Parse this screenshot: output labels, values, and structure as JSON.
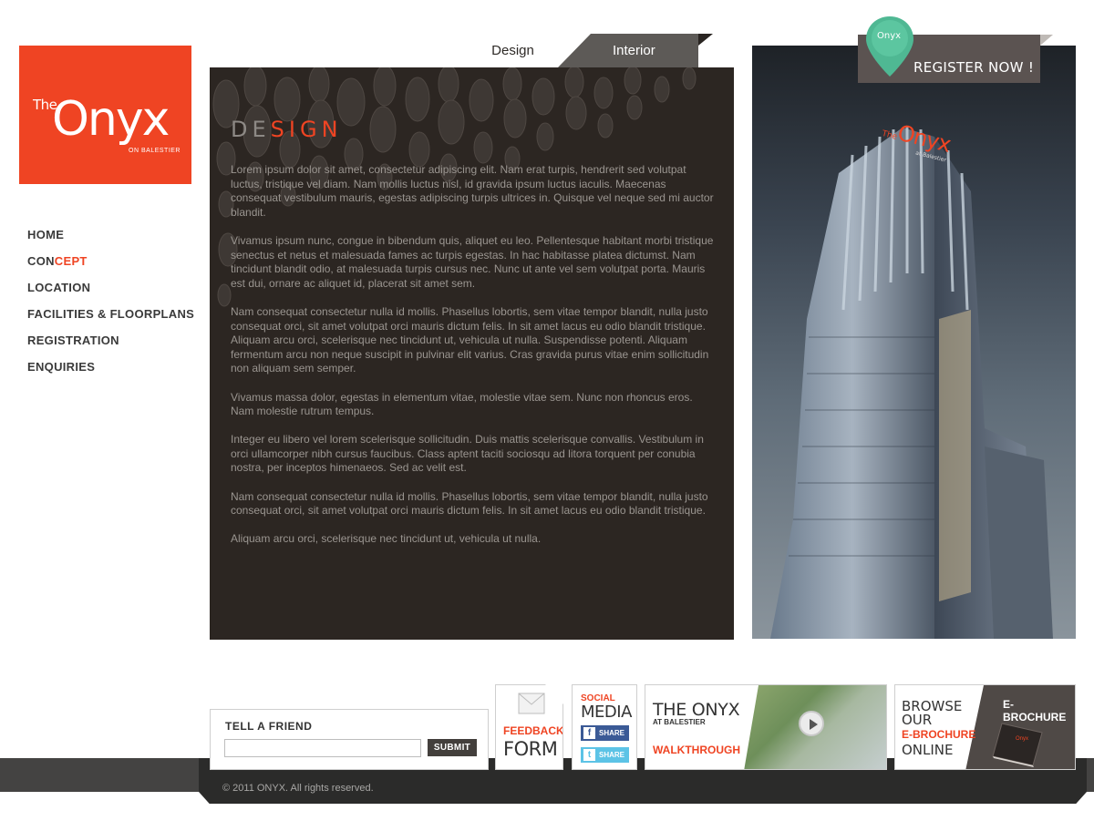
{
  "logo": {
    "the": "The",
    "word": "Onyx",
    "sub": "ON BALESTIER"
  },
  "nav": {
    "items": [
      {
        "label": "HOME"
      },
      {
        "pre": "CON",
        "hl": "CEPT"
      },
      {
        "label": "LOCATION"
      },
      {
        "label": "FACILITIES & FLOORPLANS"
      },
      {
        "label": "REGISTRATION"
      },
      {
        "label": "ENQUIRIES"
      }
    ]
  },
  "tabs": {
    "design": "Design",
    "interior": "Interior"
  },
  "content": {
    "heading_pre": "DE",
    "heading_hl": "SIGN",
    "paragraphs": [
      "Lorem ipsum dolor sit amet, consectetur adipiscing elit. Nam erat turpis, hendrerit sed volutpat luctus, tristique vel diam. Nam mollis luctus nisl, id gravida ipsum luctus iaculis. Maecenas consequat vestibulum mauris, egestas adipiscing turpis ultrices in. Quisque vel neque sed mi auctor blandit.",
      "Vivamus ipsum nunc, congue in bibendum quis, aliquet eu leo. Pellentesque habitant morbi tristique senectus et netus et malesuada fames ac turpis egestas. In hac habitasse platea dictumst. Nam tincidunt blandit odio, at malesuada turpis cursus nec. Nunc ut ante vel sem volutpat porta. Mauris est dui, ornare ac aliquet id, placerat sit amet sem.",
      "Nam consequat consectetur nulla id mollis. Phasellus lobortis, sem vitae tempor blandit, nulla justo consequat orci, sit amet volutpat orci mauris dictum felis. In sit amet lacus eu odio blandit tristique. Aliquam arcu orci, scelerisque nec tincidunt ut, vehicula ut nulla. Suspendisse potenti. Aliquam fermentum arcu non neque suscipit in pulvinar elit varius. Cras gravida purus vitae enim sollicitudin non aliquam sem semper.",
      "Vivamus massa dolor, egestas in elementum vitae, molestie vitae sem. Nunc non rhoncus eros. Nam molestie rutrum tempus.",
      "Integer eu libero vel lorem scelerisque sollicitudin. Duis mattis scelerisque convallis. Vestibulum in orci ullamcorper nibh cursus faucibus. Class aptent taciti sociosqu ad litora torquent per conubia nostra, per inceptos himenaeos. Sed ac velit est.",
      "Nam consequat consectetur nulla id mollis. Phasellus lobortis, sem vitae tempor blandit, nulla justo consequat orci, sit amet volutpat orci mauris dictum felis. In sit amet lacus eu odio blandit tristique.",
      "Aliquam arcu orci, scelerisque nec tincidunt ut, vehicula ut nulla."
    ]
  },
  "register": {
    "label": "REGISTER NOW !",
    "pin_text": "Onyx"
  },
  "building_sign": {
    "the": "The",
    "word": "Onyx",
    "sub": "at Balestier"
  },
  "tell_friend": {
    "label": "TELL A FRIEND",
    "input_value": "",
    "submit": "SUBMIT"
  },
  "feedback": {
    "line1": "FEEDBACK",
    "line2": "FORM"
  },
  "social": {
    "line1": "SOCIAL",
    "line2": "MEDIA",
    "share": "SHARE",
    "fb_icon": "f",
    "tw_icon": "t"
  },
  "walkthrough": {
    "title": "THE ONYX",
    "sub": "AT BALESTIER",
    "link": "WALKTHROUGH"
  },
  "ebrochure": {
    "l1": "BROWSE",
    "l2": "OUR",
    "l3": "E-BROCHURE",
    "l4": "ONLINE",
    "badge": "E-BROCHURE",
    "book_text": "Onyx"
  },
  "footer": {
    "copyright": "© 2011 ONYX. All rights reserved."
  },
  "colors": {
    "accent": "#ef4423",
    "panel": "#2c2622",
    "dark": "#444342"
  }
}
